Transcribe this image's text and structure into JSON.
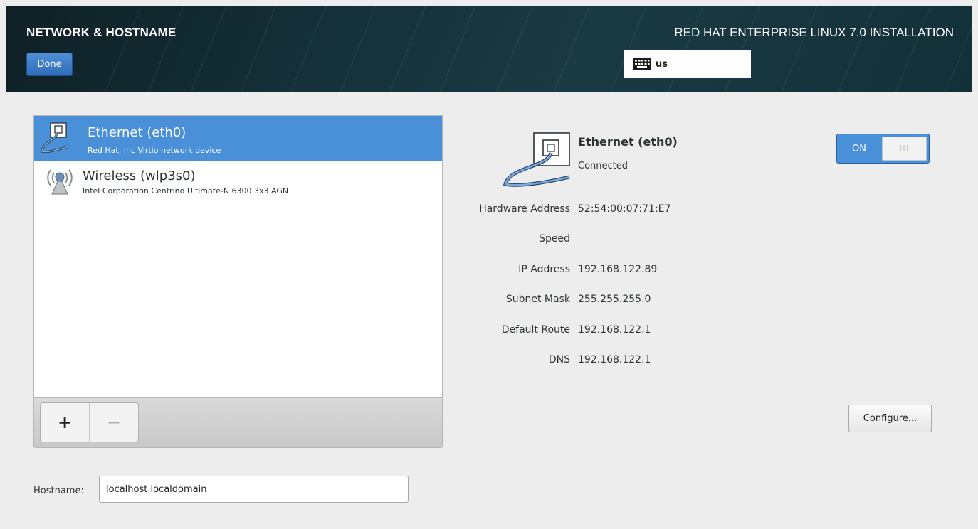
{
  "header": {
    "spoke_title": "NETWORK & HOSTNAME",
    "done_label": "Done",
    "product_title": "RED HAT ENTERPRISE LINUX 7.0 INSTALLATION",
    "keyboard_layout": "us"
  },
  "devices": [
    {
      "name": "Ethernet (eth0)",
      "description": "Red Hat, Inc Virtio network device",
      "icon": "ethernet-icon",
      "selected": true
    },
    {
      "name": "Wireless (wlp3s0)",
      "description": "Intel Corporation Centrino Ultimate-N 6300 3x3 AGN",
      "icon": "wireless-icon",
      "selected": false
    }
  ],
  "list_toolbar": {
    "add_label": "+",
    "remove_label": "−"
  },
  "hostname": {
    "label": "Hostname:",
    "value": "localhost.localdomain"
  },
  "detail": {
    "name": "Ethernet (eth0)",
    "status": "Connected",
    "toggle_label": "ON",
    "toggle_knob": "III",
    "toggle_state": "on",
    "properties": [
      {
        "key": "Hardware Address",
        "value": "52:54:00:07:71:E7"
      },
      {
        "key": "Speed",
        "value": ""
      },
      {
        "key": "IP Address",
        "value": "192.168.122.89"
      },
      {
        "key": "Subnet Mask",
        "value": "255.255.255.0"
      },
      {
        "key": "Default Route",
        "value": "192.168.122.1"
      },
      {
        "key": "DNS",
        "value": "192.168.122.1"
      }
    ],
    "configure_label": "Configure..."
  },
  "colors": {
    "accent": "#4a90d9",
    "header_bg": "#15313a",
    "window_bg": "#ededed"
  }
}
